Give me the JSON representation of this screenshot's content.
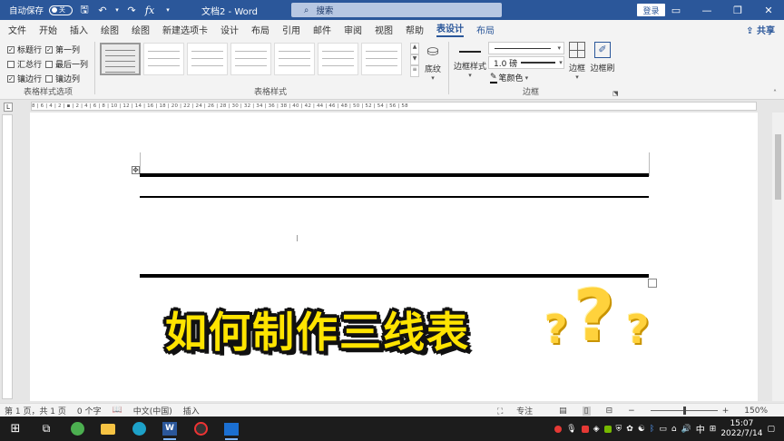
{
  "titlebar": {
    "autosave_label": "自动保存",
    "autosave_state": "关",
    "doc_title": "文档2 - Word",
    "search_placeholder": "搜索",
    "login_label": "登录",
    "minimize": "—",
    "restore": "❐",
    "close": "✕"
  },
  "tabs": [
    "文件",
    "开始",
    "插入",
    "绘图",
    "绘图",
    "新建选项卡",
    "设计",
    "布局",
    "引用",
    "邮件",
    "审阅",
    "视图",
    "帮助",
    "表设计",
    "布局"
  ],
  "active_tab": "表设计",
  "share_label": "共享",
  "ribbon": {
    "style_options": {
      "label": "表格样式选项",
      "items": [
        {
          "label": "标题行",
          "checked": true
        },
        {
          "label": "第一列",
          "checked": true
        },
        {
          "label": "汇总行",
          "checked": false
        },
        {
          "label": "最后一列",
          "checked": false
        },
        {
          "label": "镶边行",
          "checked": true
        },
        {
          "label": "镶边列",
          "checked": false
        }
      ]
    },
    "table_styles_label": "表格样式",
    "shading_label": "底纹",
    "borders_group": {
      "label": "边框",
      "border_styles_label": "边框样式",
      "weight_value": "1.0 磅",
      "pen_color_label": "笔颜色",
      "borders_label": "边框",
      "border_painter_label": "边框刷"
    }
  },
  "ruler_text": "8 | 6 | 4 | 2 | ▪ | 2 | 4 | 6 | 8 | 10 | 12 | 14 | 16 | 18 | 20 | 22 | 24 | 26 | 28 | 30 | 32 | 34 | 36 | 38 | 40 | 42 | 44 | 46 | 48 | 50 | 52 | 54 | 56 | 58",
  "overlay": {
    "title": "如何制作三线表",
    "qmarks": [
      "?",
      "?",
      "?"
    ]
  },
  "statusbar": {
    "page": "第 1 页，共 1 页",
    "words": "0 个字",
    "language": "中文(中国)",
    "mode": "插入",
    "focus": "专注",
    "zoom": "150%"
  },
  "tray": {
    "ime": "中",
    "time": "15:07",
    "date": "2022/7/14"
  },
  "colors": {
    "word_blue": "#2b579a",
    "overlay_yellow": "#ffe400"
  }
}
